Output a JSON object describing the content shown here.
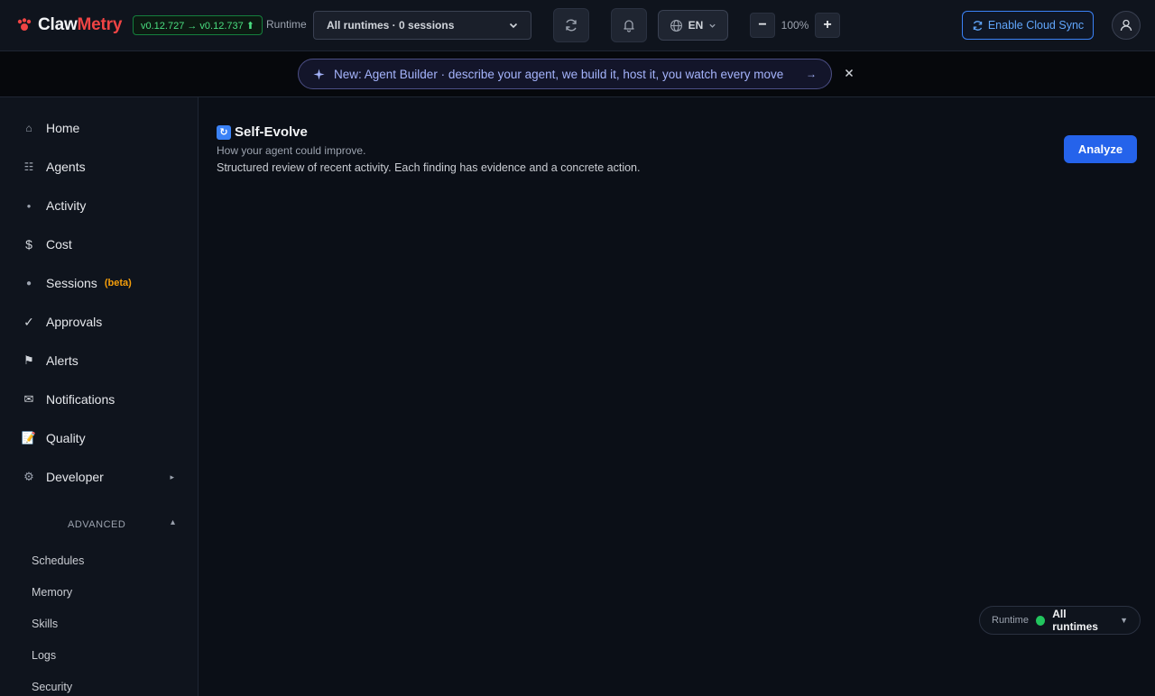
{
  "app": {
    "name_part1": "Claw",
    "name_part2": "Metry",
    "version": "v0.12.727 → v0.12.737 ⬆"
  },
  "topbar": {
    "runtime_label": "Runtime",
    "runtime_selected": "All runtimes · 0 sessions",
    "language": "EN",
    "zoom_level": "100%",
    "zoom_out": "−",
    "zoom_in": "+",
    "cloud_sync_label": "Enable Cloud Sync"
  },
  "banner": {
    "text": "New: Agent Builder · describe your agent, we build it, host it, you watch every move",
    "arrow": "→"
  },
  "sidebar": {
    "items": [
      {
        "label": "Home",
        "icon": "⌂"
      },
      {
        "label": "Agents",
        "icon": "☷"
      },
      {
        "label": "Activity",
        "icon": "●"
      },
      {
        "label": "Cost",
        "icon": "$"
      },
      {
        "label": "Sessions",
        "icon": "●",
        "badge": "(beta)"
      },
      {
        "label": "Approvals",
        "icon": "✓"
      },
      {
        "label": "Alerts",
        "icon": "⚑"
      },
      {
        "label": "Notifications",
        "icon": "✉"
      },
      {
        "label": "Quality",
        "icon": "📝"
      },
      {
        "label": "Developer",
        "icon": "⚙",
        "expand": "▸"
      }
    ],
    "advanced_label": "ADVANCED",
    "advanced_caret": "▴",
    "advanced_items": [
      "Schedules",
      "Memory",
      "Skills",
      "Logs",
      "Security"
    ]
  },
  "main": {
    "title_icon": "↻",
    "title": "Self-Evolve",
    "subtitle": "How your agent could improve.",
    "description": "Structured review of recent activity. Each finding has evidence and a concrete action.",
    "analyze_label": "Analyze"
  },
  "runtime_chip": {
    "label": "Runtime",
    "value": "All runtimes",
    "caret": "▼"
  },
  "colors": {
    "accent": "#2563eb",
    "brand_red": "#ef4444",
    "version_green": "#4ade80",
    "beta_amber": "#f59e0b"
  }
}
